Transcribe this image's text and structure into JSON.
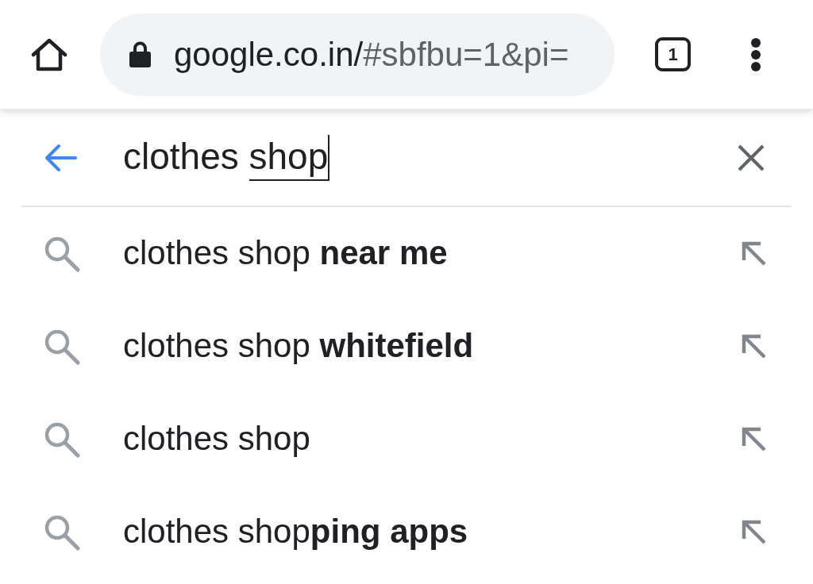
{
  "toolbar": {
    "address_bar": {
      "secure": true,
      "host": "google.co.in/",
      "path": "#sbfbu=1&pi="
    },
    "tab_count": "1"
  },
  "search": {
    "query_parts": [
      {
        "text": "clothes",
        "composing": false
      },
      {
        "text": "shop",
        "composing": true
      }
    ]
  },
  "suggestions": [
    {
      "text": "clothes shop **near me**"
    },
    {
      "text": "clothes shop **whitefield**"
    },
    {
      "text": "clothes shop"
    },
    {
      "text": "clothes shop**ping apps**"
    }
  ]
}
